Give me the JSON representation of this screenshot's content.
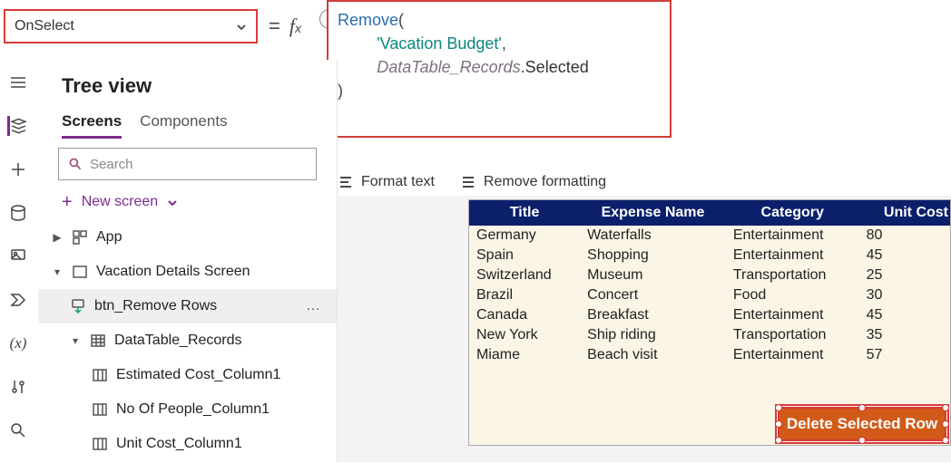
{
  "property_dropdown": {
    "value": "OnSelect"
  },
  "formula": {
    "func": "Remove",
    "arg_string": "'Vacation Budget'",
    "arg_ident": "DataTable_Records",
    "arg_prop": "Selected"
  },
  "tree": {
    "title": "Tree view",
    "tabs": {
      "screens": "Screens",
      "components": "Components"
    },
    "search_placeholder": "Search",
    "new_screen_label": "New screen",
    "items": {
      "app": "App",
      "screen": "Vacation Details Screen",
      "btn": "btn_Remove Rows",
      "table": "DataTable_Records",
      "col1": "Estimated Cost_Column1",
      "col2": "No Of People_Column1",
      "col3": "Unit Cost_Column1"
    }
  },
  "toolbar": {
    "format_text": "Format text",
    "remove_formatting": "Remove formatting"
  },
  "datatable": {
    "headers": [
      "Title",
      "Expense Name",
      "Category",
      "Unit Cost"
    ],
    "rows": [
      [
        "Germany",
        "Waterfalls",
        "Entertainment",
        "80"
      ],
      [
        "Spain",
        "Shopping",
        "Entertainment",
        "45"
      ],
      [
        "Switzerland",
        "Museum",
        "Transportation",
        "25"
      ],
      [
        "Brazil",
        "Concert",
        "Food",
        "30"
      ],
      [
        "Canada",
        "Breakfast",
        "Entertainment",
        "45"
      ],
      [
        "New York",
        "Ship riding",
        "Transportation",
        "35"
      ],
      [
        "Miame",
        "Beach visit",
        "Entertainment",
        "57"
      ]
    ]
  },
  "buttons": {
    "delete_selected": "Delete Selected Row"
  }
}
